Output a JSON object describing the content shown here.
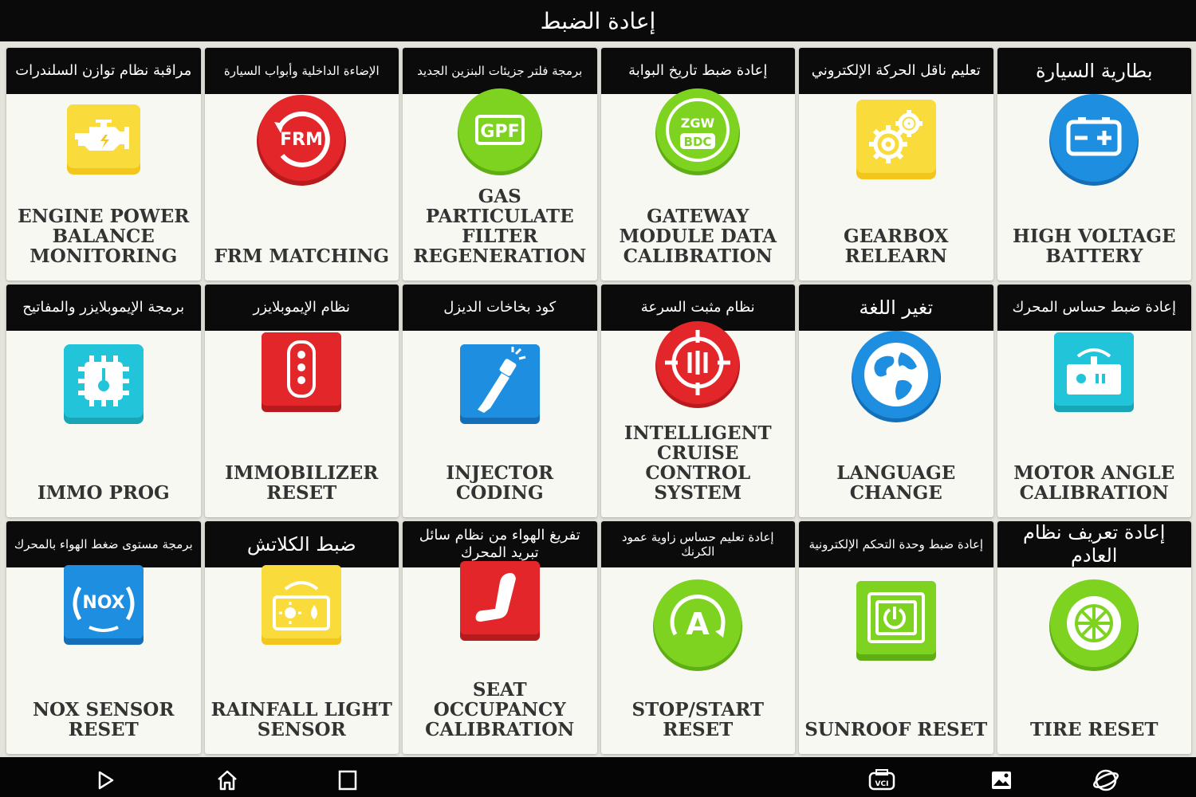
{
  "header": {
    "title": "إعادة الضبط"
  },
  "tiles": [
    {
      "ar": "مراقبة نظام توازن السلندرات",
      "label": "ENGINE POWER\nBALANCE\nMONITORING",
      "icon": "engine-icon"
    },
    {
      "ar": "الإضاءة الداخلية وأبواب السيارة",
      "label": "FRM MATCHING",
      "icon": "frm-icon",
      "icon_text": "FRM"
    },
    {
      "ar": "برمجة فلتر جزيئات البنزين الجديد",
      "label": "GAS PARTICULATE\nFILTER\nREGENERATION",
      "icon": "gpf-icon",
      "icon_text": "GPF"
    },
    {
      "ar": "إعادة ضبط تاريخ البوابة",
      "label": "GATEWAY\nMODULE DATA\nCALIBRATION",
      "icon": "gateway-icon",
      "icon_text": "ZGW",
      "icon_text2": "BDC"
    },
    {
      "ar": "تعليم ناقل الحركة الإلكتروني",
      "label": "GEARBOX\nRELEARN",
      "icon": "gears-icon"
    },
    {
      "ar": "بطارية السيارة",
      "label": "HIGH VOLTAGE\nBATTERY",
      "icon": "battery-icon"
    },
    {
      "ar": "برمجة الإيموبلايزر والمفاتيح",
      "label": "IMMO PROG",
      "icon": "chip-key-icon"
    },
    {
      "ar": "نظام الإيموبلايزر",
      "label": "IMMOBILIZER\nRESET",
      "icon": "key-fob-icon"
    },
    {
      "ar": "كود بخاخات الديزل",
      "label": "INJECTOR CODING",
      "icon": "injector-icon"
    },
    {
      "ar": "نظام مثبت السرعة",
      "label": "INTELLIGENT\nCRUISE CONTROL\nSYSTEM",
      "icon": "cruise-control-icon"
    },
    {
      "ar": "تغير اللغة",
      "label": "LANGUAGE\nCHANGE",
      "icon": "globe-icon"
    },
    {
      "ar": "إعادة ضبط حساس المحرك",
      "label": "MOTOR ANGLE\nCALIBRATION",
      "icon": "motor-angle-icon"
    },
    {
      "ar": "برمجة مستوى ضغط الهواء بالمحرك",
      "label": "NOX SENSOR\nRESET",
      "icon": "nox-icon",
      "icon_text": "NOX"
    },
    {
      "ar": "ضبط الكلاتش",
      "label": "RAINFALL LIGHT\nSENSOR",
      "icon": "rain-light-sensor-icon"
    },
    {
      "ar": "تفريغ الهواء من نظام سائل تبريد المحرك",
      "label": "SEAT OCCUPANCY\nCALIBRATION",
      "icon": "seat-icon"
    },
    {
      "ar": "إعادة تعليم حساس زاوية عمود الكرنك",
      "label": "STOP/START RESET",
      "icon": "auto-stop-start-icon",
      "icon_text": "A"
    },
    {
      "ar": "إعادة ضبط وحدة التحكم الإلكترونية",
      "label": "SUNROOF RESET",
      "icon": "sunroof-icon"
    },
    {
      "ar": "إعادة تعريف نظام العادم",
      "label": "TIRE RESET",
      "icon": "tire-icon"
    }
  ],
  "nav": [
    "back-icon",
    "home-icon",
    "recent-apps-icon",
    "vci-icon",
    "screenshot-icon",
    "browser-icon"
  ],
  "nav_text": {
    "vci": "VCI"
  },
  "colors": {
    "yellow": "#f5d52a",
    "red": "#e3262a",
    "green": "#7ed321",
    "blue": "#1e8fe0",
    "cyan": "#21c4d8"
  }
}
